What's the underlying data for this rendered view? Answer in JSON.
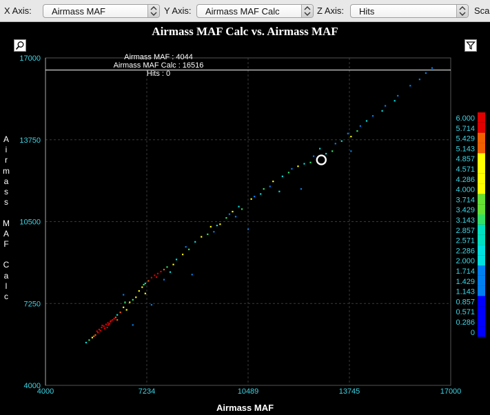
{
  "toolbar": {
    "x_axis_label": "X Axis:",
    "x_axis_value": "Airmass MAF",
    "y_axis_label": "Y Axis:",
    "y_axis_value": "Airmass MAF Calc",
    "z_axis_label": "Z Axis:",
    "z_axis_value": "Hits",
    "scale_label": "Sca"
  },
  "icons": {
    "zoom": "zoom-icon",
    "filter": "filter-icon"
  },
  "hover": {
    "line1": "Airmass MAF : 4044",
    "line2": "Airmass MAF Calc : 16516",
    "line3": "Hits : 0"
  },
  "colors": {
    "tick_label": "#3bd6e6",
    "background": "#000000",
    "grid": "#3a3a3a"
  },
  "chart_data": {
    "type": "scatter",
    "title": "Airmass MAF Calc vs. Airmass MAF",
    "xlabel": "Airmass MAF",
    "ylabel": "Airmass MAF Calc",
    "xlim": [
      4000,
      17000
    ],
    "ylim": [
      4000,
      17000
    ],
    "x_ticks": [
      "4000",
      "7234",
      "10489",
      "13745",
      "17000"
    ],
    "y_ticks": [
      "4000",
      "7250",
      "10500",
      "13750",
      "17000"
    ],
    "grid": true,
    "z_axis": "Hits",
    "colorbar": {
      "min": 0,
      "max": 6,
      "ticks": [
        "6.000",
        "5.714",
        "5.429",
        "5.143",
        "4.857",
        "4.571",
        "4.286",
        "4.000",
        "3.714",
        "3.429",
        "3.143",
        "2.857",
        "2.571",
        "2.286",
        "2.000",
        "1.714",
        "1.429",
        "1.143",
        "0.857",
        "0.571",
        "0.286",
        "0"
      ],
      "colors": [
        "#e00000",
        "#e00000",
        "#f06000",
        "#f06000",
        "#ffff00",
        "#ffff00",
        "#ffff00",
        "#ffff00",
        "#66e033",
        "#66e033",
        "#33e066",
        "#00e0c0",
        "#00e0c0",
        "#00e0e0",
        "#00e0e0",
        "#0080f0",
        "#0080f0",
        "#0080f0",
        "#0000ff",
        "#0000ff",
        "#0000ff",
        "#0000ff"
      ]
    },
    "crosshair_y": 16516,
    "selected_point": [
      12850,
      12950
    ],
    "series": [
      {
        "hits": 6,
        "points": [
          [
            5650,
            6150
          ],
          [
            5720,
            6220
          ],
          [
            5800,
            6300
          ],
          [
            5870,
            6350
          ],
          [
            5940,
            6420
          ],
          [
            6000,
            6480
          ],
          [
            6080,
            6530
          ],
          [
            6150,
            6600
          ],
          [
            5760,
            6180
          ],
          [
            5900,
            6260
          ],
          [
            6020,
            6400
          ],
          [
            6100,
            6560
          ],
          [
            5820,
            6380
          ],
          [
            5980,
            6300
          ],
          [
            6200,
            6650
          ],
          [
            5680,
            6100
          ],
          [
            6050,
            6450
          ],
          [
            7400,
            8280
          ],
          [
            7500,
            8370
          ],
          [
            7600,
            8440
          ],
          [
            7700,
            8520
          ],
          [
            7560,
            8300
          ]
        ]
      },
      {
        "hits": 5,
        "points": [
          [
            5600,
            6000
          ],
          [
            6250,
            6700
          ],
          [
            6400,
            6900
          ],
          [
            7300,
            8150
          ],
          [
            7800,
            8600
          ],
          [
            5550,
            5950
          ],
          [
            6300,
            6600
          ]
        ]
      },
      {
        "hits": 4,
        "points": [
          [
            5500,
            5900
          ],
          [
            6500,
            7100
          ],
          [
            6700,
            7300
          ],
          [
            6900,
            7500
          ],
          [
            7000,
            7750
          ],
          [
            7100,
            7900
          ],
          [
            8400,
            9200
          ],
          [
            9000,
            9900
          ],
          [
            9300,
            10300
          ],
          [
            10000,
            10900
          ],
          [
            10600,
            11400
          ],
          [
            11300,
            12100
          ],
          [
            12100,
            12700
          ],
          [
            13800,
            13880
          ],
          [
            6600,
            7000
          ],
          [
            7200,
            7650
          ],
          [
            8100,
            8800
          ],
          [
            9600,
            10400
          ]
        ]
      },
      {
        "hits": 3,
        "points": [
          [
            6800,
            7400
          ],
          [
            7900,
            8700
          ],
          [
            8600,
            9400
          ],
          [
            9200,
            10000
          ],
          [
            9800,
            10650
          ],
          [
            10300,
            11000
          ],
          [
            11000,
            11800
          ],
          [
            11800,
            12450
          ],
          [
            12500,
            12850
          ],
          [
            13200,
            13300
          ],
          [
            14000,
            14100
          ],
          [
            5400,
            5800
          ],
          [
            6550,
            7300
          ],
          [
            7150,
            8000
          ]
        ]
      },
      {
        "hits": 2,
        "points": [
          [
            7200,
            8050
          ],
          [
            8200,
            9000
          ],
          [
            8800,
            9700
          ],
          [
            9500,
            10350
          ],
          [
            10200,
            11100
          ],
          [
            10900,
            11600
          ],
          [
            11600,
            12300
          ],
          [
            12300,
            12800
          ],
          [
            13000,
            13200
          ],
          [
            13500,
            13700
          ],
          [
            14300,
            14500
          ],
          [
            14800,
            14900
          ],
          [
            15200,
            15300
          ],
          [
            5300,
            5700
          ],
          [
            6300,
            6800
          ],
          [
            8000,
            8500
          ],
          [
            11500,
            11700
          ],
          [
            12800,
            13400
          ]
        ]
      },
      {
        "hits": 1,
        "points": [
          [
            6500,
            7600
          ],
          [
            7800,
            8200
          ],
          [
            8500,
            9500
          ],
          [
            9400,
            10100
          ],
          [
            10100,
            10700
          ],
          [
            10700,
            11500
          ],
          [
            11200,
            11900
          ],
          [
            11900,
            12600
          ],
          [
            12600,
            13100
          ],
          [
            13300,
            13600
          ],
          [
            13700,
            14000
          ],
          [
            14100,
            14300
          ],
          [
            14500,
            14700
          ],
          [
            14900,
            15100
          ],
          [
            15300,
            15500
          ],
          [
            15700,
            15900
          ],
          [
            16000,
            16150
          ],
          [
            16200,
            16400
          ],
          [
            16400,
            16600
          ],
          [
            6800,
            6400
          ],
          [
            8700,
            8400
          ],
          [
            7400,
            7200
          ],
          [
            10500,
            10200
          ],
          [
            12200,
            11800
          ],
          [
            13800,
            13300
          ],
          [
            9900,
            10800
          ]
        ]
      }
    ]
  }
}
